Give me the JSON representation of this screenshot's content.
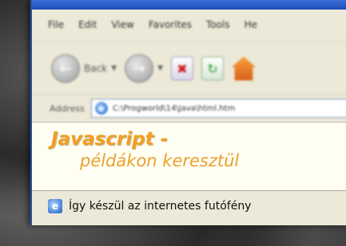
{
  "menu": {
    "items": [
      "File",
      "Edit",
      "View",
      "Favorites",
      "Tools",
      "He"
    ]
  },
  "toolbar": {
    "back_label": "Back",
    "back_icon": "back-arrow-icon",
    "forward_icon": "forward-arrow-icon",
    "stop_icon": "stop-icon",
    "refresh_icon": "refresh-icon",
    "home_icon": "home-icon"
  },
  "address": {
    "label": "Address",
    "value": "C:\\Progworld\\14\\Java\\html.htm"
  },
  "content": {
    "title": "Javascript -",
    "subtitle": "példákon keresztül",
    "title_color": "#f0a020"
  },
  "status": {
    "text": "Így készül az internetes futófény"
  }
}
